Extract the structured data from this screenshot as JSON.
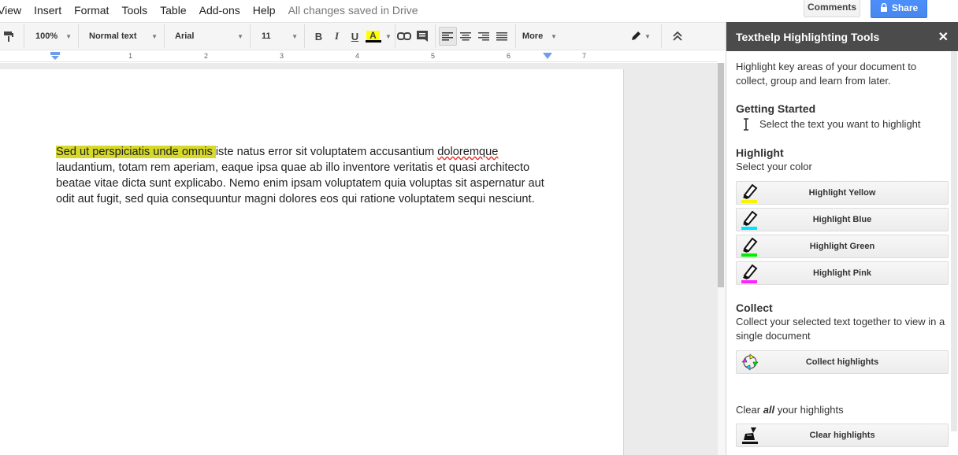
{
  "menu": {
    "items": [
      "View",
      "Insert",
      "Format",
      "Tools",
      "Table",
      "Add-ons",
      "Help"
    ],
    "saved_status": "All changes saved in Drive"
  },
  "header_buttons": {
    "comments": "Comments",
    "share": "Share"
  },
  "toolbar": {
    "zoom": "100%",
    "style": "Normal text",
    "font": "Arial",
    "size": "11",
    "bold": "B",
    "italic": "I",
    "underline": "U",
    "text_color": "A",
    "more": "More"
  },
  "ruler": {
    "numbers": [
      "1",
      "2",
      "3",
      "4",
      "5",
      "6",
      "7"
    ]
  },
  "document": {
    "highlighted": "Sed ut perspiciatis unde omnis ",
    "text_1": "iste natus error sit voluptatem accusantium ",
    "misspelled": "doloremque",
    "text_2": " laudantium, totam rem aperiam, eaque ipsa quae ab illo inventore veritatis et quasi architecto beatae vitae dicta sunt explicabo. Nemo enim ipsam voluptatem quia voluptas sit aspernatur aut odit aut fugit, sed quia consequuntur magni dolores eos qui ratione voluptatem sequi nesciunt.",
    "highlight_color": "#d6d82a"
  },
  "sidebar": {
    "title": "Texthelp Highlighting Tools",
    "close": "✕",
    "intro": "Highlight key areas of your document to collect, group and learn from later.",
    "getting_started": {
      "heading": "Getting Started",
      "instruction": "Select the text you want to highlight"
    },
    "highlight": {
      "heading": "Highlight",
      "subheading": "Select your color",
      "buttons": [
        {
          "label": "Highlight Yellow",
          "color": "#f5f500",
          "icon": "highlighter-yellow-icon"
        },
        {
          "label": "Highlight Blue",
          "color": "#00e5ff",
          "icon": "highlighter-blue-icon"
        },
        {
          "label": "Highlight Green",
          "color": "#00ee00",
          "icon": "highlighter-green-icon"
        },
        {
          "label": "Highlight Pink",
          "color": "#ff22ff",
          "icon": "highlighter-pink-icon"
        }
      ]
    },
    "collect": {
      "heading": "Collect",
      "description": "Collect your selected text together to view in a single document",
      "button": "Collect highlights"
    },
    "clear": {
      "text_before": "Clear ",
      "text_emph": "all",
      "text_after": " your highlights",
      "button": "Clear highlights"
    }
  }
}
